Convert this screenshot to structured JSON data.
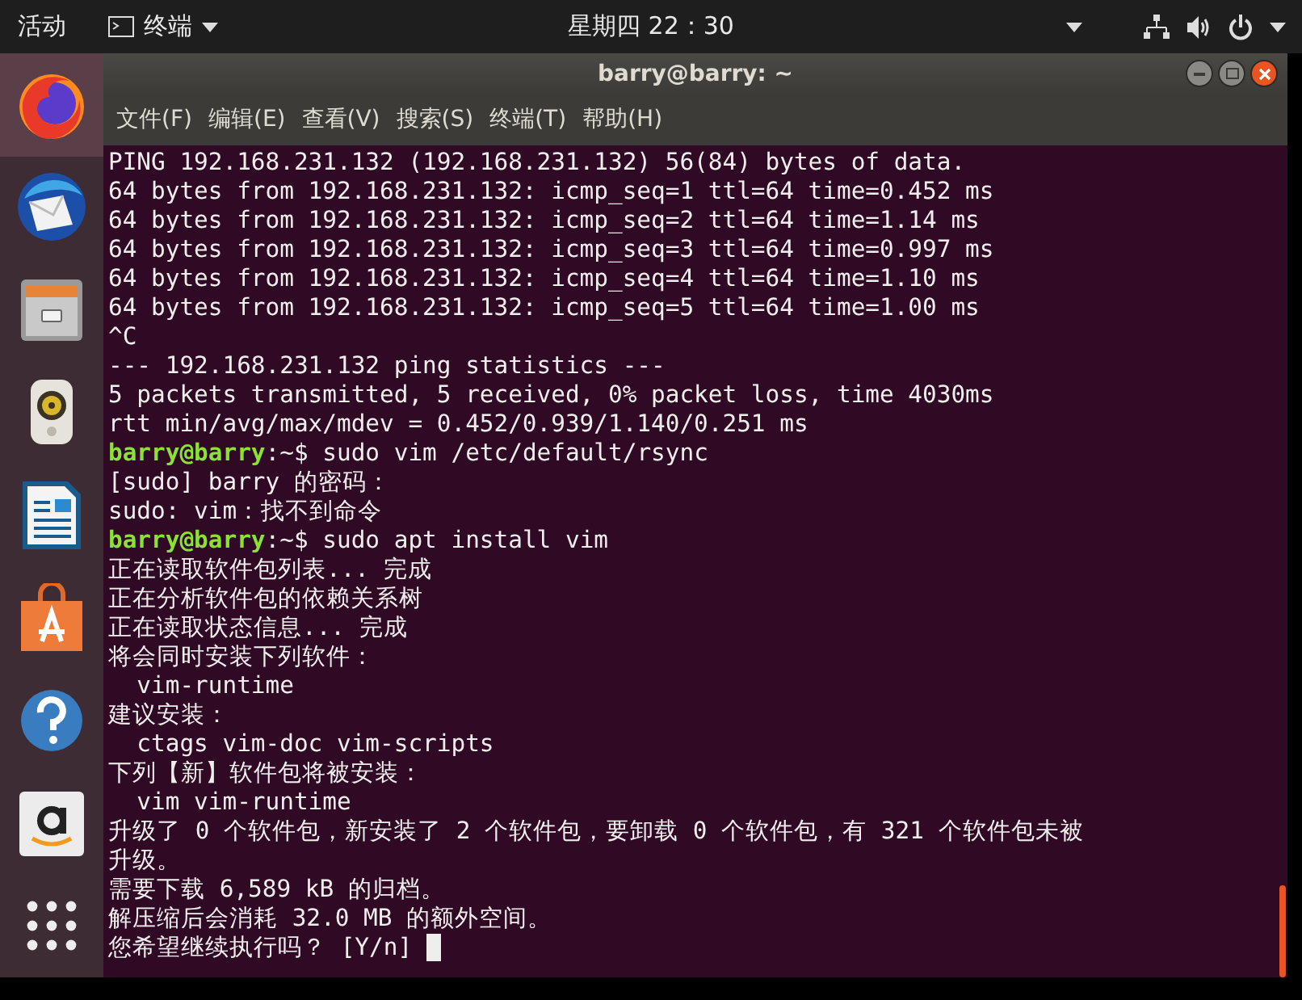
{
  "top_bar": {
    "activities": "活动",
    "app_menu": "终端",
    "clock": "星期四 22：30"
  },
  "dock": {
    "items": [
      {
        "kind": "firefox",
        "selected": true
      },
      {
        "kind": "mail",
        "selected": false
      },
      {
        "kind": "files",
        "selected": false
      },
      {
        "kind": "speaker",
        "selected": false
      },
      {
        "kind": "writer",
        "selected": false
      },
      {
        "kind": "store",
        "selected": false
      },
      {
        "kind": "help",
        "selected": false
      },
      {
        "kind": "amazon",
        "selected": false
      },
      {
        "kind": "grid",
        "selected": false
      }
    ]
  },
  "window": {
    "title": "barry@barry: ~"
  },
  "menu": [
    "文件(F)",
    "编辑(E)",
    "查看(V)",
    "搜索(S)",
    "终端(T)",
    "帮助(H)"
  ],
  "terminal": {
    "lines": [
      {
        "kind": "out",
        "text": "PING 192.168.231.132 (192.168.231.132) 56(84) bytes of data."
      },
      {
        "kind": "out",
        "text": "64 bytes from 192.168.231.132: icmp_seq=1 ttl=64 time=0.452 ms"
      },
      {
        "kind": "out",
        "text": "64 bytes from 192.168.231.132: icmp_seq=2 ttl=64 time=1.14 ms"
      },
      {
        "kind": "out",
        "text": "64 bytes from 192.168.231.132: icmp_seq=3 ttl=64 time=0.997 ms"
      },
      {
        "kind": "out",
        "text": "64 bytes from 192.168.231.132: icmp_seq=4 ttl=64 time=1.10 ms"
      },
      {
        "kind": "out",
        "text": "64 bytes from 192.168.231.132: icmp_seq=5 ttl=64 time=1.00 ms"
      },
      {
        "kind": "out",
        "text": "^C"
      },
      {
        "kind": "out",
        "text": "--- 192.168.231.132 ping statistics ---"
      },
      {
        "kind": "out",
        "text": "5 packets transmitted, 5 received, 0% packet loss, time 4030ms"
      },
      {
        "kind": "out",
        "text": "rtt min/avg/max/mdev = 0.452/0.939/1.140/0.251 ms"
      },
      {
        "kind": "prompt",
        "user": "barry@barry",
        "path": ":~$",
        "text": "sudo vim /etc/default/rsync"
      },
      {
        "kind": "out",
        "text": "[sudo] barry 的密码："
      },
      {
        "kind": "out",
        "text": "sudo: vim：找不到命令"
      },
      {
        "kind": "prompt",
        "user": "barry@barry",
        "path": ":~$",
        "text": "sudo apt install vim"
      },
      {
        "kind": "out",
        "text": "正在读取软件包列表... 完成"
      },
      {
        "kind": "out",
        "text": "正在分析软件包的依赖关系树"
      },
      {
        "kind": "out",
        "text": "正在读取状态信息... 完成"
      },
      {
        "kind": "out",
        "text": "将会同时安装下列软件："
      },
      {
        "kind": "out",
        "text": "  vim-runtime"
      },
      {
        "kind": "out",
        "text": "建议安装："
      },
      {
        "kind": "out",
        "text": "  ctags vim-doc vim-scripts"
      },
      {
        "kind": "out",
        "text": "下列【新】软件包将被安装："
      },
      {
        "kind": "out",
        "text": "  vim vim-runtime"
      },
      {
        "kind": "out",
        "text": "升级了 0 个软件包，新安装了 2 个软件包，要卸载 0 个软件包，有 321 个软件包未被"
      },
      {
        "kind": "out",
        "text": "升级。"
      },
      {
        "kind": "out",
        "text": "需要下载 6,589 kB 的归档。"
      },
      {
        "kind": "out",
        "text": "解压缩后会消耗 32.0 MB 的额外空间。"
      },
      {
        "kind": "out",
        "text": "您希望继续执行吗？ [Y/n]",
        "cursor": true
      }
    ]
  }
}
